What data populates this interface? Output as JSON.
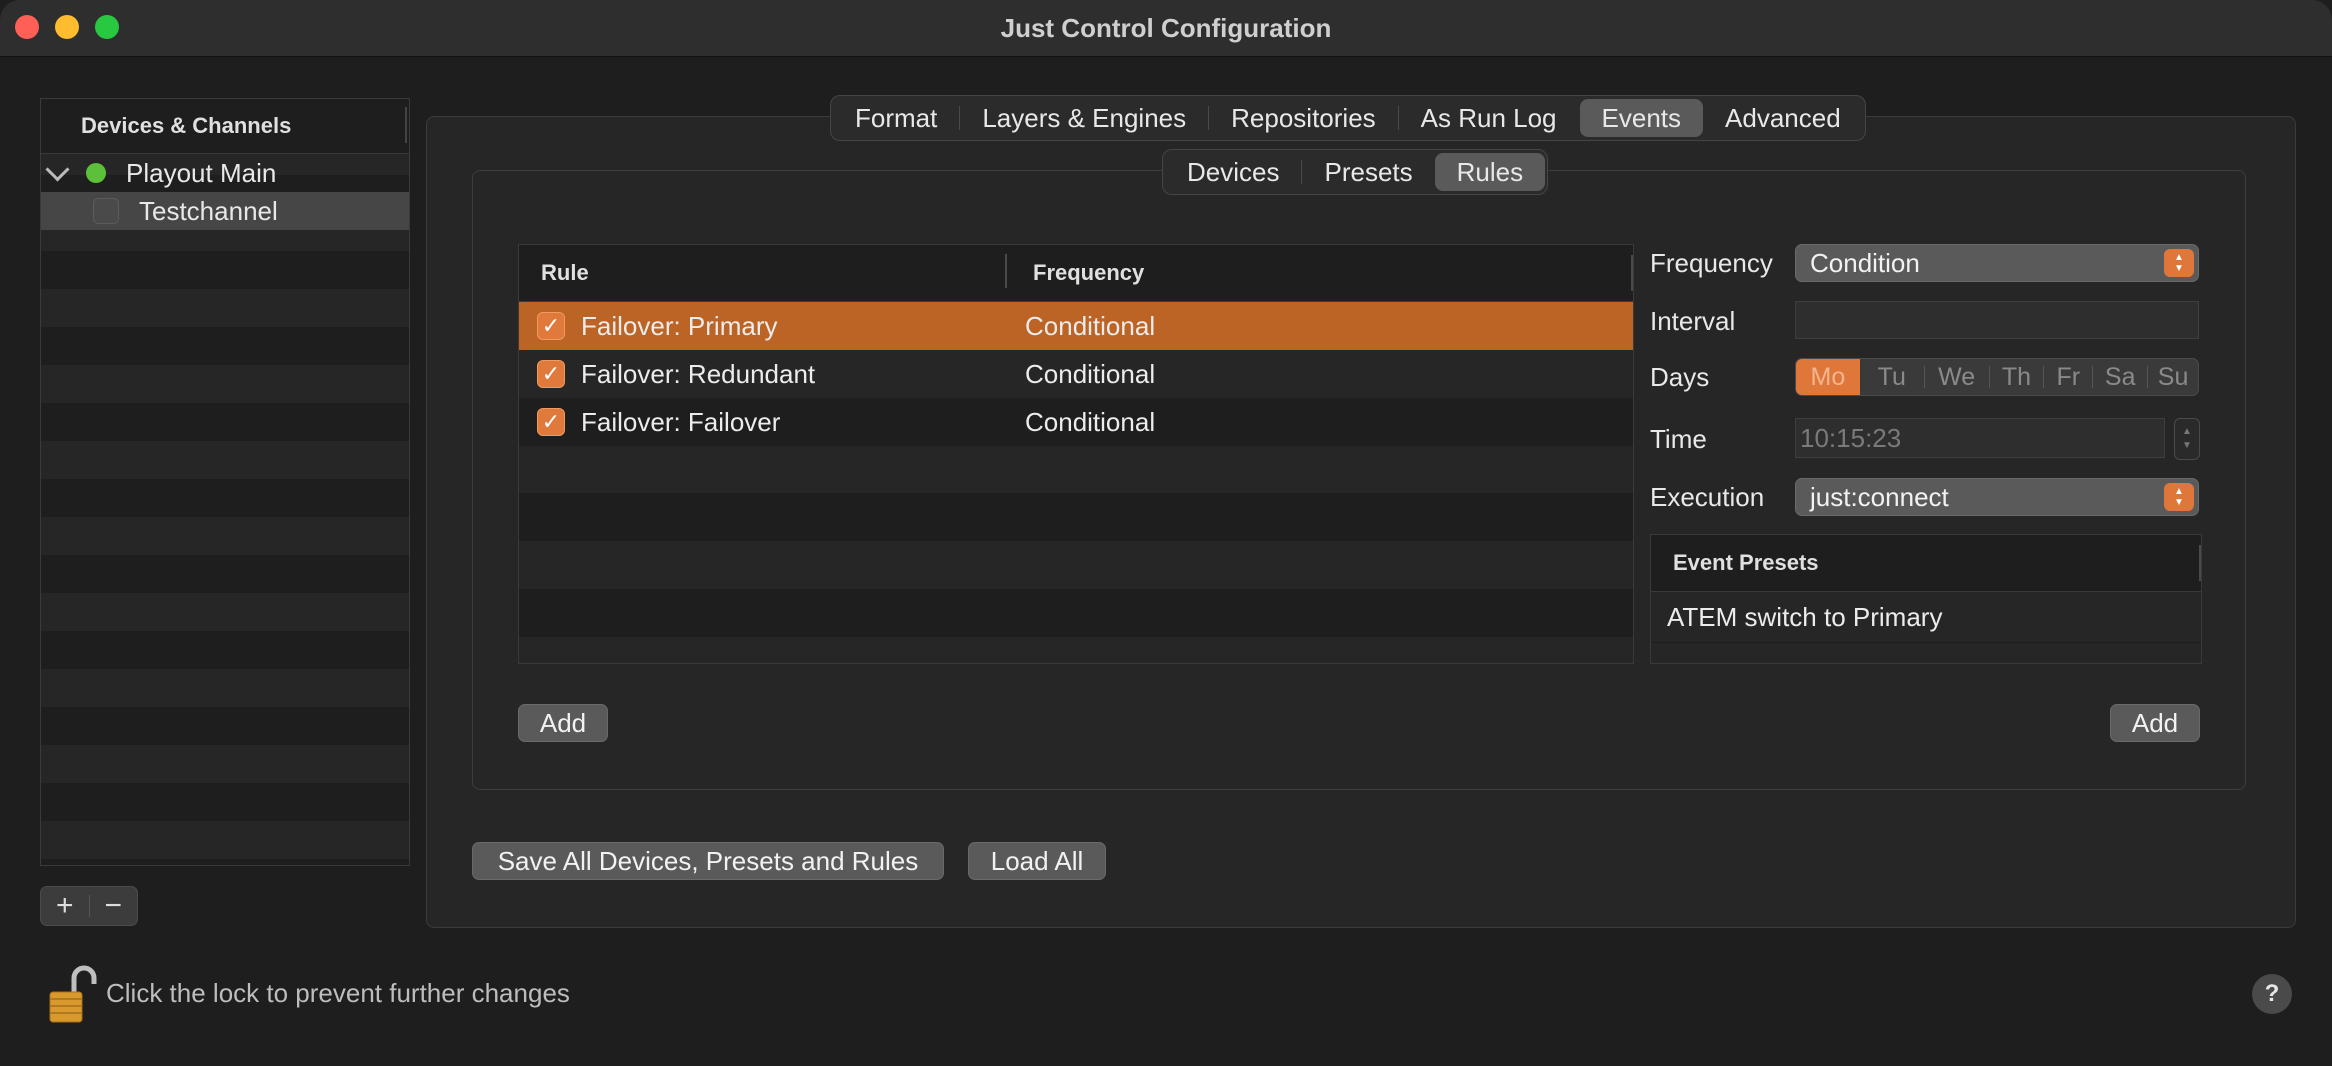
{
  "window": {
    "title": "Just Control Configuration"
  },
  "sidebar": {
    "header": "Devices & Channels",
    "items": [
      {
        "label": "Playout Main",
        "status_color": "#5cc03a",
        "expanded": true
      },
      {
        "label": "Testchannel",
        "selected": true
      }
    ],
    "add_symbol": "+",
    "remove_symbol": "−"
  },
  "tabs": {
    "items": [
      "Format",
      "Layers & Engines",
      "Repositories",
      "As Run Log",
      "Events",
      "Advanced"
    ],
    "active": "Events"
  },
  "subtabs": {
    "items": [
      "Devices",
      "Presets",
      "Rules"
    ],
    "active": "Rules"
  },
  "rules_table": {
    "columns": [
      "Rule",
      "Frequency"
    ],
    "rows": [
      {
        "checked": true,
        "rule": "Failover: Primary",
        "frequency": "Conditional",
        "selected": true
      },
      {
        "checked": true,
        "rule": "Failover: Redundant",
        "frequency": "Conditional"
      },
      {
        "checked": true,
        "rule": "Failover: Failover",
        "frequency": "Conditional"
      }
    ],
    "add_label": "Add"
  },
  "form": {
    "frequency_label": "Frequency",
    "frequency_value": "Condition",
    "interval_label": "Interval",
    "interval_value": "",
    "days_label": "Days",
    "days": [
      "Mo",
      "Tu",
      "We",
      "Th",
      "Fr",
      "Sa",
      "Su"
    ],
    "days_selected": [
      "Mo"
    ],
    "time_label": "Time",
    "time_value": "10:15:23",
    "execution_label": "Execution",
    "execution_value": "just:connect"
  },
  "event_presets": {
    "header": "Event Presets",
    "rows": [
      "ATEM switch to Primary"
    ],
    "add_label": "Add"
  },
  "footer": {
    "save_all_label": "Save All Devices, Presets and Rules",
    "load_all_label": "Load All",
    "lock_text": "Click the lock to prevent further changes",
    "help_symbol": "?"
  },
  "colors": {
    "accent": "#e0773a",
    "selection": "#bc6426"
  }
}
